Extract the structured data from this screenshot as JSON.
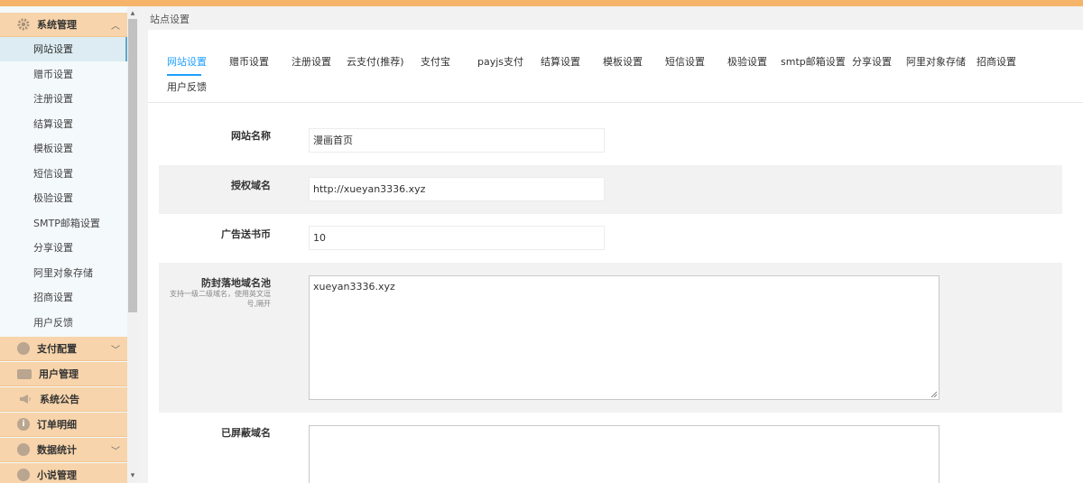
{
  "sidebar": {
    "group_system": "系统管理",
    "items": [
      {
        "label": "网站设置"
      },
      {
        "label": "赠币设置"
      },
      {
        "label": "注册设置"
      },
      {
        "label": "结算设置"
      },
      {
        "label": "模板设置"
      },
      {
        "label": "短信设置"
      },
      {
        "label": "极验设置"
      },
      {
        "label": "SMTP邮箱设置"
      },
      {
        "label": "分享设置"
      },
      {
        "label": "阿里对象存储"
      },
      {
        "label": "招商设置"
      },
      {
        "label": "用户反馈"
      }
    ],
    "groups": [
      {
        "label": "支付配置",
        "icon": "circle-icon"
      },
      {
        "label": "用户管理",
        "icon": "id-card-icon"
      },
      {
        "label": "系统公告",
        "icon": "megaphone-icon"
      },
      {
        "label": "订单明细",
        "icon": "info-icon"
      },
      {
        "label": "数据统计",
        "icon": "chart-icon"
      },
      {
        "label": "小说管理",
        "icon": "book-icon"
      }
    ]
  },
  "breadcrumb": "站点设置",
  "tabs": [
    {
      "label": "网站设置"
    },
    {
      "label": "赠币设置"
    },
    {
      "label": "注册设置"
    },
    {
      "label": "云支付(推荐)"
    },
    {
      "label": "支付宝"
    },
    {
      "label": "payjs支付"
    },
    {
      "label": "结算设置"
    },
    {
      "label": "模板设置"
    },
    {
      "label": "短信设置"
    },
    {
      "label": "极验设置"
    },
    {
      "label": "smtp邮箱设置"
    },
    {
      "label": "分享设置"
    },
    {
      "label": "阿里对象存储"
    },
    {
      "label": "招商设置"
    },
    {
      "label": "用户反馈"
    }
  ],
  "form": {
    "site_name": {
      "label": "网站名称",
      "value": "漫画首页"
    },
    "auth_domain": {
      "label": "授权域名",
      "value": "http://xueyan3336.xyz"
    },
    "ad_coins": {
      "label": "广告送书币",
      "value": "10"
    },
    "landing_pool": {
      "label": "防封落地域名池",
      "hint": "支持一级二级域名，使用英文逗号,隔开",
      "value": "xueyan3336.xyz"
    },
    "blocked_domains": {
      "label": "已屏蔽域名",
      "value": ""
    }
  },
  "colors": {
    "accent": "#1e9fff",
    "topbar": "#f5b46a",
    "group_bg": "#f7d4ab",
    "active_item_bg": "#dcecf2"
  }
}
